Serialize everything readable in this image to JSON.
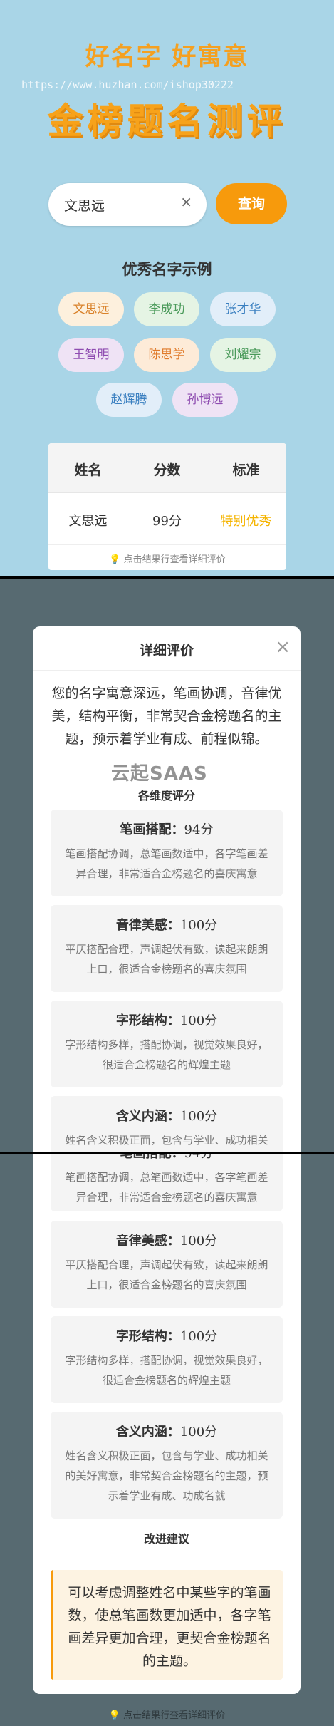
{
  "header": {
    "title_line1": "好名字 好寓意",
    "watermark": "https://www.huzhan.com/ishop30222",
    "title_line2": "金榜题名测评"
  },
  "search": {
    "value": "文思远",
    "clear_icon": "×",
    "button_label": "查询"
  },
  "examples": {
    "title": "优秀名字示例",
    "chips": [
      {
        "label": "文思远",
        "color": "#d9822b",
        "bg": "#fdf0dd"
      },
      {
        "label": "李成功",
        "color": "#4a9a5a",
        "bg": "#e5f4e4"
      },
      {
        "label": "张才华",
        "color": "#3a7fc0",
        "bg": "#e2eef9"
      },
      {
        "label": "王智明",
        "color": "#8f4db1",
        "bg": "#efe3f5"
      },
      {
        "label": "陈思学",
        "color": "#e07a2a",
        "bg": "#fdebd8"
      },
      {
        "label": "刘耀宗",
        "color": "#4a9a5a",
        "bg": "#e5f4e4"
      },
      {
        "label": "赵辉腾",
        "color": "#3a7fc0",
        "bg": "#e2eef9"
      },
      {
        "label": "孙博远",
        "color": "#8f4db1",
        "bg": "#efe3f5"
      }
    ]
  },
  "result_table": {
    "headers": [
      "姓名",
      "分数",
      "标准"
    ],
    "row": {
      "name": "文思远",
      "score": "99分",
      "level": "特别优秀"
    },
    "level_color": "#f5b400",
    "hint_icon": "💡",
    "hint": "点击结果行查看详细评价"
  },
  "modal": {
    "title": "详细评价",
    "close_icon": "×",
    "summary": "您的名字寓意深远，笔画协调，音律优美，结构平衡，非常契合金榜题名的主题，预示着学业有成、前程似锦。",
    "dimensions_title": "各维度评分",
    "dimensions": [
      {
        "name": "笔画搭配：",
        "score": "94分",
        "desc": "笔画搭配协调，总笔画数适中，各字笔画差异合理，非常适合金榜题名的喜庆寓意"
      },
      {
        "name": "音律美感：",
        "score": "100分",
        "desc": "平仄搭配合理，声调起伏有致，读起来朗朗上口，很适合金榜题名的喜庆氛围"
      },
      {
        "name": "字形结构：",
        "score": "100分",
        "desc": "字形结构多样，搭配协调，视觉效果良好，很适合金榜题名的辉煌主题"
      },
      {
        "name": "含义内涵：",
        "score": "100分",
        "desc": "姓名含义积极正面，包含与学业、成功相关的美好寓意，非常契合金榜题名的主题，预示着学业有成、功成名就"
      }
    ],
    "saas_mark": "云起SAAS",
    "advice_title": "改进建议",
    "advice": "可以考虑调整姓名中某些字的笔画数，使总笔画数更加适中，各字笔画差异更加合理，更契合金榜题名的主题。"
  }
}
